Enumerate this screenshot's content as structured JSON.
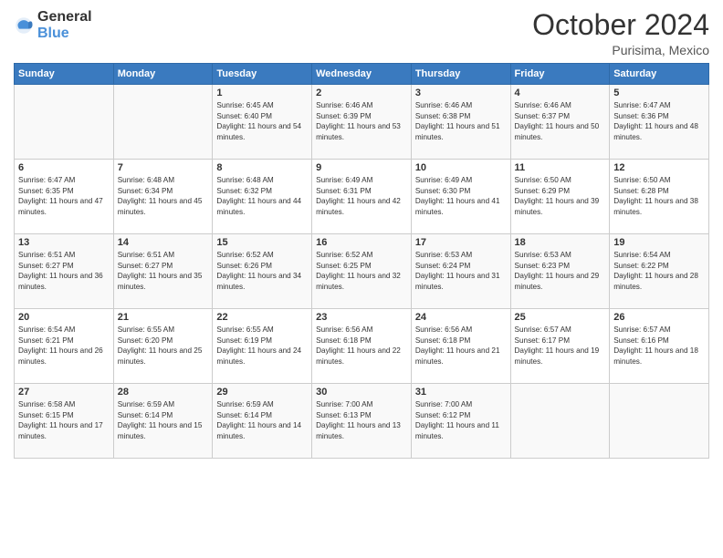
{
  "header": {
    "logo_general": "General",
    "logo_blue": "Blue",
    "month": "October 2024",
    "location": "Purisima, Mexico"
  },
  "weekdays": [
    "Sunday",
    "Monday",
    "Tuesday",
    "Wednesday",
    "Thursday",
    "Friday",
    "Saturday"
  ],
  "weeks": [
    [
      {
        "day": "",
        "empty": true
      },
      {
        "day": "",
        "empty": true
      },
      {
        "day": "1",
        "sunrise": "Sunrise: 6:45 AM",
        "sunset": "Sunset: 6:40 PM",
        "daylight": "Daylight: 11 hours and 54 minutes."
      },
      {
        "day": "2",
        "sunrise": "Sunrise: 6:46 AM",
        "sunset": "Sunset: 6:39 PM",
        "daylight": "Daylight: 11 hours and 53 minutes."
      },
      {
        "day": "3",
        "sunrise": "Sunrise: 6:46 AM",
        "sunset": "Sunset: 6:38 PM",
        "daylight": "Daylight: 11 hours and 51 minutes."
      },
      {
        "day": "4",
        "sunrise": "Sunrise: 6:46 AM",
        "sunset": "Sunset: 6:37 PM",
        "daylight": "Daylight: 11 hours and 50 minutes."
      },
      {
        "day": "5",
        "sunrise": "Sunrise: 6:47 AM",
        "sunset": "Sunset: 6:36 PM",
        "daylight": "Daylight: 11 hours and 48 minutes."
      }
    ],
    [
      {
        "day": "6",
        "sunrise": "Sunrise: 6:47 AM",
        "sunset": "Sunset: 6:35 PM",
        "daylight": "Daylight: 11 hours and 47 minutes."
      },
      {
        "day": "7",
        "sunrise": "Sunrise: 6:48 AM",
        "sunset": "Sunset: 6:34 PM",
        "daylight": "Daylight: 11 hours and 45 minutes."
      },
      {
        "day": "8",
        "sunrise": "Sunrise: 6:48 AM",
        "sunset": "Sunset: 6:32 PM",
        "daylight": "Daylight: 11 hours and 44 minutes."
      },
      {
        "day": "9",
        "sunrise": "Sunrise: 6:49 AM",
        "sunset": "Sunset: 6:31 PM",
        "daylight": "Daylight: 11 hours and 42 minutes."
      },
      {
        "day": "10",
        "sunrise": "Sunrise: 6:49 AM",
        "sunset": "Sunset: 6:30 PM",
        "daylight": "Daylight: 11 hours and 41 minutes."
      },
      {
        "day": "11",
        "sunrise": "Sunrise: 6:50 AM",
        "sunset": "Sunset: 6:29 PM",
        "daylight": "Daylight: 11 hours and 39 minutes."
      },
      {
        "day": "12",
        "sunrise": "Sunrise: 6:50 AM",
        "sunset": "Sunset: 6:28 PM",
        "daylight": "Daylight: 11 hours and 38 minutes."
      }
    ],
    [
      {
        "day": "13",
        "sunrise": "Sunrise: 6:51 AM",
        "sunset": "Sunset: 6:27 PM",
        "daylight": "Daylight: 11 hours and 36 minutes."
      },
      {
        "day": "14",
        "sunrise": "Sunrise: 6:51 AM",
        "sunset": "Sunset: 6:27 PM",
        "daylight": "Daylight: 11 hours and 35 minutes."
      },
      {
        "day": "15",
        "sunrise": "Sunrise: 6:52 AM",
        "sunset": "Sunset: 6:26 PM",
        "daylight": "Daylight: 11 hours and 34 minutes."
      },
      {
        "day": "16",
        "sunrise": "Sunrise: 6:52 AM",
        "sunset": "Sunset: 6:25 PM",
        "daylight": "Daylight: 11 hours and 32 minutes."
      },
      {
        "day": "17",
        "sunrise": "Sunrise: 6:53 AM",
        "sunset": "Sunset: 6:24 PM",
        "daylight": "Daylight: 11 hours and 31 minutes."
      },
      {
        "day": "18",
        "sunrise": "Sunrise: 6:53 AM",
        "sunset": "Sunset: 6:23 PM",
        "daylight": "Daylight: 11 hours and 29 minutes."
      },
      {
        "day": "19",
        "sunrise": "Sunrise: 6:54 AM",
        "sunset": "Sunset: 6:22 PM",
        "daylight": "Daylight: 11 hours and 28 minutes."
      }
    ],
    [
      {
        "day": "20",
        "sunrise": "Sunrise: 6:54 AM",
        "sunset": "Sunset: 6:21 PM",
        "daylight": "Daylight: 11 hours and 26 minutes."
      },
      {
        "day": "21",
        "sunrise": "Sunrise: 6:55 AM",
        "sunset": "Sunset: 6:20 PM",
        "daylight": "Daylight: 11 hours and 25 minutes."
      },
      {
        "day": "22",
        "sunrise": "Sunrise: 6:55 AM",
        "sunset": "Sunset: 6:19 PM",
        "daylight": "Daylight: 11 hours and 24 minutes."
      },
      {
        "day": "23",
        "sunrise": "Sunrise: 6:56 AM",
        "sunset": "Sunset: 6:18 PM",
        "daylight": "Daylight: 11 hours and 22 minutes."
      },
      {
        "day": "24",
        "sunrise": "Sunrise: 6:56 AM",
        "sunset": "Sunset: 6:18 PM",
        "daylight": "Daylight: 11 hours and 21 minutes."
      },
      {
        "day": "25",
        "sunrise": "Sunrise: 6:57 AM",
        "sunset": "Sunset: 6:17 PM",
        "daylight": "Daylight: 11 hours and 19 minutes."
      },
      {
        "day": "26",
        "sunrise": "Sunrise: 6:57 AM",
        "sunset": "Sunset: 6:16 PM",
        "daylight": "Daylight: 11 hours and 18 minutes."
      }
    ],
    [
      {
        "day": "27",
        "sunrise": "Sunrise: 6:58 AM",
        "sunset": "Sunset: 6:15 PM",
        "daylight": "Daylight: 11 hours and 17 minutes."
      },
      {
        "day": "28",
        "sunrise": "Sunrise: 6:59 AM",
        "sunset": "Sunset: 6:14 PM",
        "daylight": "Daylight: 11 hours and 15 minutes."
      },
      {
        "day": "29",
        "sunrise": "Sunrise: 6:59 AM",
        "sunset": "Sunset: 6:14 PM",
        "daylight": "Daylight: 11 hours and 14 minutes."
      },
      {
        "day": "30",
        "sunrise": "Sunrise: 7:00 AM",
        "sunset": "Sunset: 6:13 PM",
        "daylight": "Daylight: 11 hours and 13 minutes."
      },
      {
        "day": "31",
        "sunrise": "Sunrise: 7:00 AM",
        "sunset": "Sunset: 6:12 PM",
        "daylight": "Daylight: 11 hours and 11 minutes."
      },
      {
        "day": "",
        "empty": true
      },
      {
        "day": "",
        "empty": true
      }
    ]
  ]
}
